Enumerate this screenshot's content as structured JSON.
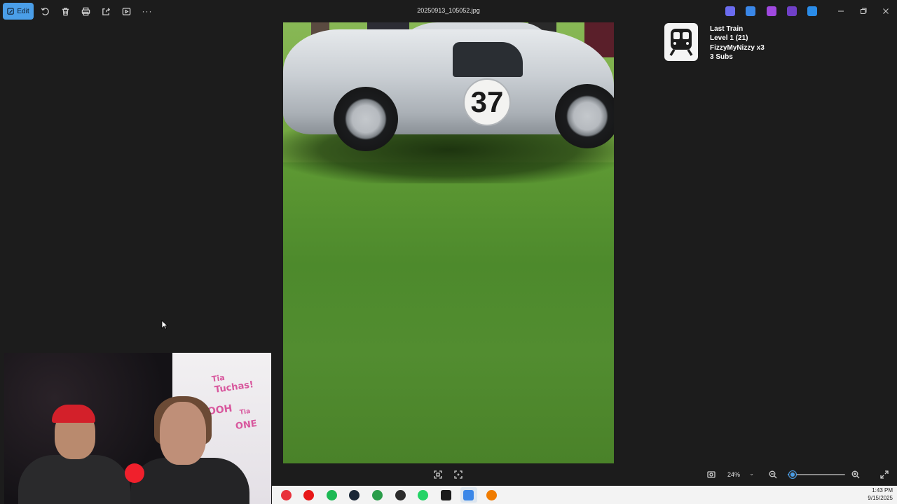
{
  "toolbar": {
    "edit_label": "Edit",
    "file_title": "20250913_105052.jpg",
    "icons": [
      "rotate-icon",
      "delete-icon",
      "print-icon",
      "share-icon",
      "slideshow-icon",
      "more-icon"
    ]
  },
  "tray_apps": [
    {
      "name": "copilot-icon",
      "color": "#6b6cf0"
    },
    {
      "name": "designer-icon",
      "color": "#3a87e8"
    },
    {
      "name": "clipchamp-icon",
      "color": "#a049e0"
    },
    {
      "name": "purple-app-icon",
      "color": "#7040c8"
    },
    {
      "name": "onedrive-icon",
      "color": "#2a8ce8"
    }
  ],
  "overlay": {
    "title": "Last Train",
    "level": "Level 1  (21)",
    "user": "FizzyMyNizzy x3",
    "subs": "3 Subs"
  },
  "photo": {
    "car_number": "37"
  },
  "webcam": {
    "writing": [
      "Tia",
      "Tuchas!",
      "OOH",
      "Tia",
      "ONE"
    ]
  },
  "viewbar": {
    "zoom_level": "24%",
    "zoom_fraction": 0.08
  },
  "taskbar": {
    "apps": [
      {
        "name": "maps-icon",
        "color": "#e8323c"
      },
      {
        "name": "youtube-icon",
        "color": "#e81818"
      },
      {
        "name": "spotify-icon",
        "color": "#1db954"
      },
      {
        "name": "steam-icon",
        "color": "#1b2838"
      },
      {
        "name": "xbox-icon",
        "color": "#2a9d4a"
      },
      {
        "name": "obs-icon",
        "color": "#2c2c2c"
      },
      {
        "name": "whatsapp-icon",
        "color": "#25d366"
      },
      {
        "name": "terminal-icon",
        "color": "#1a1a1a"
      },
      {
        "name": "photos-icon",
        "color": "#3a87e8"
      },
      {
        "name": "vlc-icon",
        "color": "#f07c00"
      }
    ],
    "time": "1:43 PM",
    "date": "9/15/2025"
  }
}
